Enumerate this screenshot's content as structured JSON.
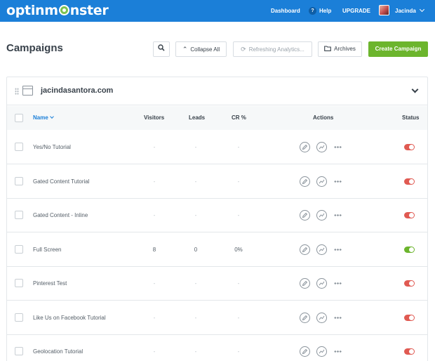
{
  "header": {
    "logo": {
      "pre": "optinm",
      "post": "nster"
    },
    "nav": {
      "dashboard": "Dashboard",
      "help": "Help",
      "help_badge": "?",
      "upgrade": "UPGRADE",
      "user": "Jacinda"
    }
  },
  "toolbar": {
    "title": "Campaigns",
    "collapse_all": "Collapse All",
    "refreshing": "Refreshing Analytics...",
    "archives": "Archives",
    "create": "Create Campaign"
  },
  "site": {
    "name": "jacindasantora.com"
  },
  "table": {
    "columns": {
      "name": "Name",
      "visitors": "Visitors",
      "leads": "Leads",
      "cr": "CR %",
      "actions": "Actions",
      "status": "Status"
    },
    "rows": [
      {
        "name": "Yes/No Tutorial",
        "visitors": "-",
        "leads": "-",
        "cr": "-",
        "status": "off"
      },
      {
        "name": "Gated Content Tutorial",
        "visitors": "-",
        "leads": "-",
        "cr": "-",
        "status": "off"
      },
      {
        "name": "Gated Content - Inline",
        "visitors": "-",
        "leads": "-",
        "cr": "-",
        "status": "off"
      },
      {
        "name": "Full Screen",
        "visitors": "8",
        "leads": "0",
        "cr": "0%",
        "status": "on"
      },
      {
        "name": "Pinterest Test",
        "visitors": "-",
        "leads": "-",
        "cr": "-",
        "status": "off"
      },
      {
        "name": "Like Us on Facebook Tutorial",
        "visitors": "-",
        "leads": "-",
        "cr": "-",
        "status": "off"
      },
      {
        "name": "Geolocation Tutorial",
        "visitors": "-",
        "leads": "-",
        "cr": "-",
        "status": "off"
      }
    ]
  },
  "colors": {
    "brand_blue": "#1b7fd8",
    "create_green": "#6cb52d",
    "toggle_off": "#e05a52",
    "toggle_on": "#6cb52d"
  }
}
